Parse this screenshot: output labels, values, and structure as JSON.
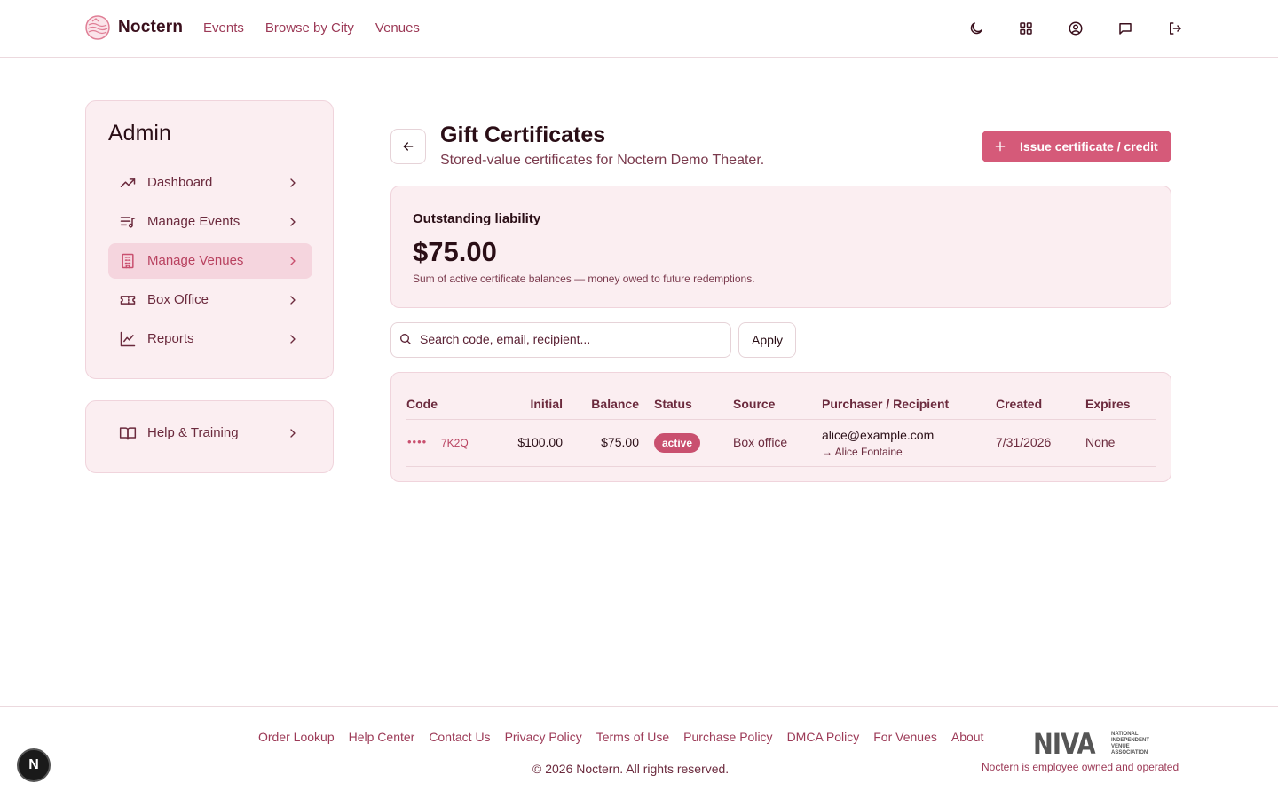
{
  "header": {
    "brand": "Noctern",
    "nav": [
      "Events",
      "Browse by City",
      "Venues"
    ],
    "icons": [
      "moon-icon",
      "grid-icon",
      "user-circle-icon",
      "message-icon",
      "logout-icon"
    ]
  },
  "sidebar": {
    "title": "Admin",
    "items": [
      {
        "label": "Dashboard",
        "icon": "trending-up-icon",
        "active": false
      },
      {
        "label": "Manage Events",
        "icon": "list-music-icon",
        "active": false
      },
      {
        "label": "Manage Venues",
        "icon": "building-icon",
        "active": true
      },
      {
        "label": "Box Office",
        "icon": "ticket-icon",
        "active": false
      },
      {
        "label": "Reports",
        "icon": "line-chart-icon",
        "active": false
      }
    ],
    "help": {
      "label": "Help & Training",
      "icon": "book-icon"
    }
  },
  "main": {
    "title": "Gift Certificates",
    "subtitle": "Stored-value certificates for Noctern Demo Theater.",
    "issue_button": "Issue certificate / credit",
    "liability": {
      "label": "Outstanding liability",
      "amount": "$75.00",
      "note": "Sum of active certificate balances — money owed to future redemptions."
    },
    "search": {
      "placeholder": "Search code, email, recipient...",
      "value": ""
    },
    "apply_button": "Apply",
    "table": {
      "columns": [
        "Code",
        "Initial",
        "Balance",
        "Status",
        "Source",
        "Purchaser / Recipient",
        "Created",
        "Expires"
      ],
      "rows": [
        {
          "code_masked": "••••",
          "code_suffix": "7K2Q",
          "initial": "$100.00",
          "balance": "$75.00",
          "status": "active",
          "source": "Box office",
          "purchaser": "alice@example.com",
          "recipient": "→ Alice Fontaine",
          "created": "7/31/2026",
          "expires": "None"
        }
      ]
    }
  },
  "footer": {
    "links": [
      "Order Lookup",
      "Help Center",
      "Contact Us",
      "Privacy Policy",
      "Terms of Use",
      "Purchase Policy",
      "DMCA Policy",
      "For Venues",
      "About"
    ],
    "copyright": "© 2026 Noctern. All rights reserved.",
    "niva_logo": "NIVA",
    "niva_full": "NATIONAL INDEPENDENT VENUE ASSOCIATION",
    "tagline": "Noctern is employee owned and operated"
  },
  "dev_badge": "N",
  "colors": {
    "accent": "#d55a79",
    "card_bg": "#fbeef1",
    "text_dark": "#2a0e16",
    "link": "#9c3a57"
  }
}
